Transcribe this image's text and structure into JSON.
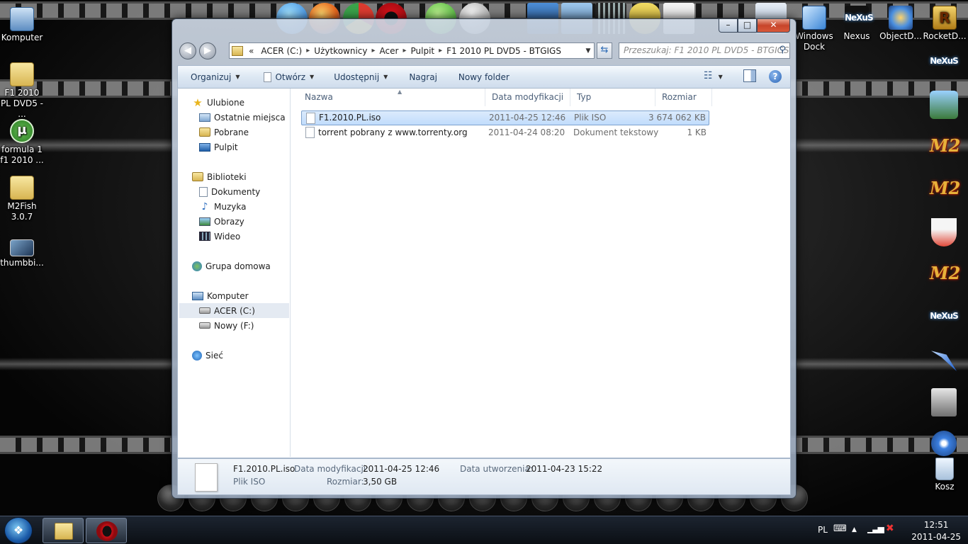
{
  "desktop": {
    "left_icons": [
      {
        "label": "Komputer",
        "icon": "computer-icon"
      },
      {
        "label": "F1 2010 PL DVD5 - ...",
        "icon": "folder-icon"
      },
      {
        "label": "formula 1 f1 2010 ...",
        "icon": "utorrent-icon"
      },
      {
        "label": "M2Fish 3.0.7",
        "icon": "folder-icon"
      },
      {
        "label": "thumbbi...",
        "icon": "thumbnail-icon"
      }
    ],
    "top_right_icons": [
      {
        "label": "Windows Dock",
        "icon": "windows-dock-icon"
      },
      {
        "label": "Nexus",
        "icon": "nexus-icon"
      },
      {
        "label": "ObjectD...",
        "icon": "objectdock-icon"
      },
      {
        "label": "RocketD...",
        "icon": "rocketdock-icon"
      }
    ],
    "right_dock": {
      "nexus_text": "NeXuS",
      "m2_text": "M2",
      "recycle_label": "Kosz"
    }
  },
  "window": {
    "buttons": {
      "minimize": "–",
      "maximize": "□",
      "close": "✕"
    },
    "nav": {
      "back": "◀",
      "forward": "▶"
    },
    "address": {
      "crumbs": [
        "ACER (C:)",
        "Użytkownicy",
        "Acer",
        "Pulpit",
        "F1 2010 PL DVD5 - BTGIGS"
      ],
      "prefix": "«",
      "separator": "▸"
    },
    "search_placeholder": "Przeszukaj: F1 2010 PL DVD5 - BTGIGS",
    "toolbar": {
      "organize": "Organizuj",
      "open": "Otwórz",
      "share": "Udostępnij",
      "burn": "Nagraj",
      "new_folder": "Nowy folder",
      "help": "?"
    },
    "sidebar": {
      "favorites": "Ulubione",
      "favorites_items": [
        "Ostatnie miejsca",
        "Pobrane",
        "Pulpit"
      ],
      "libraries": "Biblioteki",
      "libraries_items": [
        "Dokumenty",
        "Muzyka",
        "Obrazy",
        "Wideo"
      ],
      "homegroup": "Grupa domowa",
      "computer": "Komputer",
      "computer_items": [
        "ACER (C:)",
        "Nowy (F:)"
      ],
      "network": "Sieć"
    },
    "columns": {
      "name": "Nazwa",
      "modified": "Data modyfikacji",
      "type": "Typ",
      "size": "Rozmiar"
    },
    "files": [
      {
        "name": "F1.2010.PL.iso",
        "modified": "2011-04-25 12:46",
        "type": "Plik ISO",
        "size": "3 674 062 KB",
        "selected": true
      },
      {
        "name": "torrent pobrany z www.torrenty.org",
        "modified": "2011-04-24 08:20",
        "type": "Dokument tekstowy",
        "size": "1 KB",
        "selected": false
      }
    ],
    "details": {
      "file_name": "F1.2010.PL.iso",
      "file_type": "Plik ISO",
      "modified_label": "Data modyfikacji:",
      "modified_value": "2011-04-25 12:46",
      "size_label": "Rozmiar:",
      "size_value": "3,50 GB",
      "created_label": "Data utworzenia:",
      "created_value": "2011-04-23 15:22"
    }
  },
  "taskbar": {
    "language": "PL",
    "time": "12:51",
    "date": "2011-04-25"
  },
  "colors": {
    "accent": "#1e395b",
    "selection": "#c1dcfc",
    "opera_red": "#cc0f16"
  }
}
